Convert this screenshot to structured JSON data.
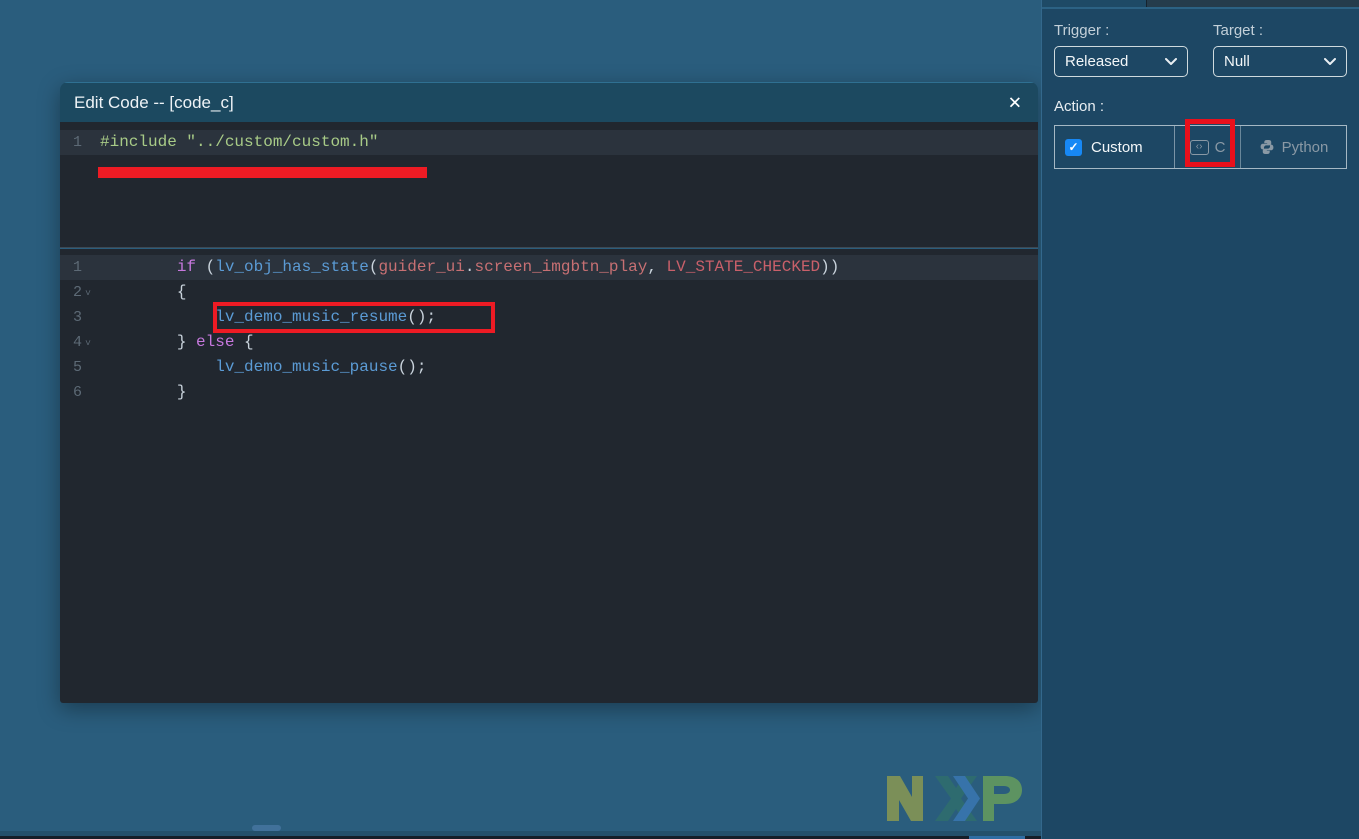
{
  "dialog": {
    "title": "Edit Code -- [code_c]",
    "code_blocks": [
      {
        "lines": [
          {
            "num": "1",
            "highlighted": true,
            "fold": false,
            "tokens": [
              {
                "c": "preproc",
                "t": "#include \"../custom/custom.h\""
              }
            ]
          }
        ]
      },
      {
        "lines": [
          {
            "num": "1",
            "highlighted": true,
            "fold": false,
            "tokens": [
              {
                "c": "plain",
                "t": "        "
              },
              {
                "c": "keyword",
                "t": "if"
              },
              {
                "c": "plain",
                "t": " ("
              },
              {
                "c": "function",
                "t": "lv_obj_has_state"
              },
              {
                "c": "plain",
                "t": "("
              },
              {
                "c": "variable",
                "t": "guider_ui"
              },
              {
                "c": "plain",
                "t": "."
              },
              {
                "c": "variable",
                "t": "screen_imgbtn_play"
              },
              {
                "c": "plain",
                "t": ", "
              },
              {
                "c": "constant",
                "t": "LV_STATE_CHECKED"
              },
              {
                "c": "plain",
                "t": "))"
              }
            ]
          },
          {
            "num": "2",
            "highlighted": false,
            "fold": true,
            "tokens": [
              {
                "c": "plain",
                "t": "        {"
              }
            ]
          },
          {
            "num": "3",
            "highlighted": false,
            "fold": false,
            "tokens": [
              {
                "c": "plain",
                "t": "            "
              },
              {
                "c": "function",
                "t": "lv_demo_music_resume"
              },
              {
                "c": "plain",
                "t": "();"
              }
            ]
          },
          {
            "num": "4",
            "highlighted": false,
            "fold": true,
            "tokens": [
              {
                "c": "plain",
                "t": "        } "
              },
              {
                "c": "keyword",
                "t": "else"
              },
              {
                "c": "plain",
                "t": " {"
              }
            ]
          },
          {
            "num": "5",
            "highlighted": false,
            "fold": false,
            "tokens": [
              {
                "c": "plain",
                "t": "            "
              },
              {
                "c": "function",
                "t": "lv_demo_music_pause"
              },
              {
                "c": "plain",
                "t": "();"
              }
            ]
          },
          {
            "num": "6",
            "highlighted": false,
            "fold": false,
            "tokens": [
              {
                "c": "plain",
                "t": "        }"
              }
            ]
          }
        ]
      }
    ]
  },
  "panel": {
    "trigger_label": "Trigger :",
    "trigger_value": "Released",
    "target_label": "Target :",
    "target_value": "Null",
    "action_label": "Action :",
    "custom_label": "Custom",
    "c_label": "C",
    "python_label": "Python"
  },
  "watermark_text": "NXP",
  "icons": {
    "close": "✕",
    "check": "✓",
    "fold": "˅",
    "code": "‹›"
  },
  "colors": {
    "canvas_bg": "#2a5d7d",
    "panel_bg": "#1d4764",
    "titlebar_bg": "#1c4960",
    "editor_bg": "#21272f",
    "editor_line_highlight": "#2b333d",
    "checkbox_accent": "#1788f5",
    "annotation_red": "#ee1b24",
    "disabled_text": "#8a99a5",
    "syntax": {
      "preproc": "#a8cb87",
      "keyword": "#c678dd",
      "function": "#5b9bd5",
      "variable": "#c77073",
      "constant": "#c9606a",
      "plain": "#c9d3dc",
      "gutter": "#5d6a76"
    }
  }
}
